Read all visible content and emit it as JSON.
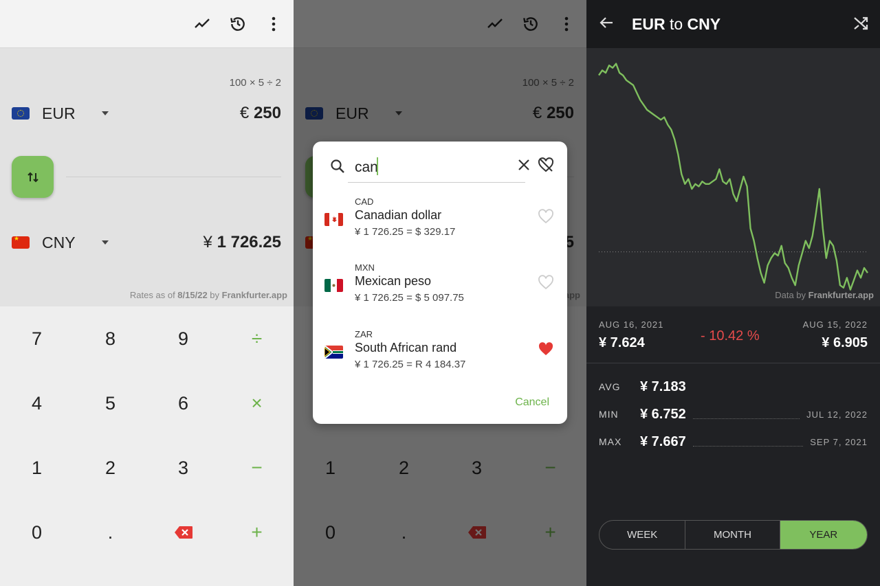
{
  "converter": {
    "expression": "100 × 5 ÷ 2",
    "from": {
      "code": "EUR",
      "symbol": "€",
      "amount": "250"
    },
    "to": {
      "code": "CNY",
      "symbol": "¥",
      "amount": "1 726.25"
    },
    "rates_prefix": "Rates as of ",
    "rates_date": "8/15/22",
    "rates_by": " by ",
    "rates_source": "Frankfurter.app",
    "keys": [
      [
        "7",
        "8",
        "9",
        "÷"
      ],
      [
        "4",
        "5",
        "6",
        "×"
      ],
      [
        "1",
        "2",
        "3",
        "−"
      ],
      [
        "0",
        ".",
        "",
        "+"
      ]
    ],
    "icons": [
      "chart-icon",
      "history-icon",
      "more-icon",
      "swap-icon",
      "backspace-icon"
    ]
  },
  "dialog": {
    "query": "can",
    "items": [
      {
        "code": "CAD",
        "name": "Canadian dollar",
        "conversion": "¥ 1 726.25 = $ 329.17",
        "favorite": false
      },
      {
        "code": "MXN",
        "name": "Mexican peso",
        "conversion": "¥ 1 726.25 = $ 5 097.75",
        "favorite": false
      },
      {
        "code": "ZAR",
        "name": "South African rand",
        "conversion": "¥ 1 726.25 = R 4 184.37",
        "favorite": true
      }
    ],
    "cancel": "Cancel"
  },
  "chart": {
    "title_from": "EUR",
    "title_to_word": " to ",
    "title_to": "CNY",
    "data_by": "Data by ",
    "data_source": "Frankfurter.app",
    "start_date": "AUG 16, 2021",
    "start_value": "¥ 7.624",
    "end_date": "AUG 15, 2022",
    "end_value": "¥ 6.905",
    "change": "- 10.42 %",
    "avg_label": "AVG",
    "avg_value": "¥ 7.183",
    "min_label": "MIN",
    "min_value": "¥ 6.752",
    "min_date": "JUL 12, 2022",
    "max_label": "MAX",
    "max_value": "¥ 7.667",
    "max_date": "SEP 7, 2021",
    "ranges": [
      "WEEK",
      "MONTH",
      "YEAR"
    ],
    "selected_range": "YEAR",
    "line_color": "#7fbf5e",
    "series": [
      7.62,
      7.64,
      7.63,
      7.66,
      7.65,
      7.667,
      7.63,
      7.62,
      7.6,
      7.59,
      7.58,
      7.55,
      7.52,
      7.5,
      7.48,
      7.47,
      7.46,
      7.45,
      7.44,
      7.45,
      7.42,
      7.4,
      7.36,
      7.3,
      7.22,
      7.18,
      7.2,
      7.16,
      7.18,
      7.17,
      7.19,
      7.18,
      7.18,
      7.19,
      7.2,
      7.24,
      7.19,
      7.18,
      7.2,
      7.14,
      7.11,
      7.16,
      7.21,
      7.17,
      7.0,
      6.95,
      6.88,
      6.82,
      6.78,
      6.85,
      6.88,
      6.9,
      6.89,
      6.93,
      6.86,
      6.84,
      6.8,
      6.77,
      6.85,
      6.9,
      6.95,
      6.92,
      6.97,
      7.06,
      7.16,
      7.0,
      6.88,
      6.95,
      6.93,
      6.87,
      6.77,
      6.76,
      6.8,
      6.752,
      6.79,
      6.83,
      6.8,
      6.84,
      6.82
    ]
  }
}
